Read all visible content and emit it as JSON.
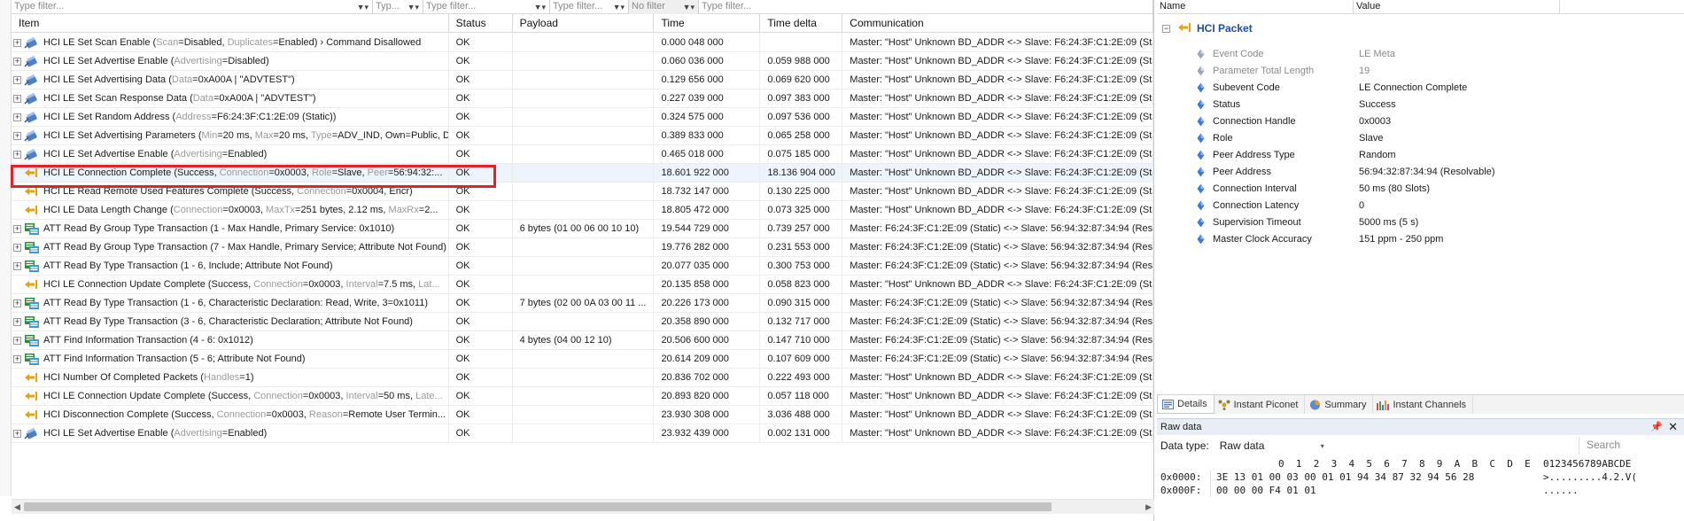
{
  "filters": {
    "item": "Type filter...",
    "status": "Typ...",
    "payload": "Type filter...",
    "time": "Type filter...",
    "delta": "No filter",
    "communication": "Type filter..."
  },
  "columns": {
    "item": "Item",
    "status": "Status",
    "payload": "Payload",
    "time": "Time",
    "delta": "Time delta",
    "communication": "Communication"
  },
  "rows": [
    {
      "kind": "cmd",
      "expand": true,
      "title": "HCI LE Set Scan Enable (",
      "p1k": "Scan",
      "p1v": "=Disabled, ",
      "p2k": "Duplicates",
      "p2v": "=Enabled) › Command Disallowed",
      "p3k": "",
      "p3v": "",
      "status": "OK",
      "payload": "",
      "time": "0.000 048 000",
      "delta": "",
      "comm": "Master: \"Host\" Unknown BD_ADDR <-> Slave: F6:24:3F:C1:2E:09 (Stat"
    },
    {
      "kind": "cmd",
      "expand": true,
      "title": "HCI LE Set Advertise Enable (",
      "p1k": "Advertising",
      "p1v": "=Disabled)",
      "p2k": "",
      "p2v": "",
      "p3k": "",
      "p3v": "",
      "status": "OK",
      "payload": "",
      "time": "0.060 036 000",
      "delta": "0.059 988 000",
      "comm": "Master: \"Host\" Unknown BD_ADDR <-> Slave: F6:24:3F:C1:2E:09 (Stat"
    },
    {
      "kind": "cmd",
      "expand": true,
      "title": "HCI LE Set Advertising Data (",
      "p1k": "Data",
      "p1v": "=0xA00A | \"ADVTEST\")",
      "p2k": "",
      "p2v": "",
      "p3k": "",
      "p3v": "",
      "status": "OK",
      "payload": "",
      "time": "0.129 656 000",
      "delta": "0.069 620 000",
      "comm": "Master: \"Host\" Unknown BD_ADDR <-> Slave: F6:24:3F:C1:2E:09 (Stat"
    },
    {
      "kind": "cmd",
      "expand": true,
      "title": "HCI LE Set Scan Response Data (",
      "p1k": "Data",
      "p1v": "=0xA00A | \"ADVTEST\")",
      "p2k": "",
      "p2v": "",
      "p3k": "",
      "p3v": "",
      "status": "OK",
      "payload": "",
      "time": "0.227 039 000",
      "delta": "0.097 383 000",
      "comm": "Master: \"Host\" Unknown BD_ADDR <-> Slave: F6:24:3F:C1:2E:09 (Stat"
    },
    {
      "kind": "cmd",
      "expand": true,
      "title": "HCI LE Set Random Address (",
      "p1k": "Address",
      "p1v": "=F6:24:3F:C1:2E:09 (Static))",
      "p2k": "",
      "p2v": "",
      "p3k": "",
      "p3v": "",
      "status": "OK",
      "payload": "",
      "time": "0.324 575 000",
      "delta": "0.097 536 000",
      "comm": "Master: \"Host\" Unknown BD_ADDR <-> Slave: F6:24:3F:C1:2E:09 (Stat"
    },
    {
      "kind": "cmd",
      "expand": true,
      "title": "HCI LE Set Advertising Parameters (",
      "p1k": "Min",
      "p1v": "=20 ms, ",
      "p2k": "Max",
      "p2v": "=20 ms, ",
      "p3k": "Type",
      "p3v": "=ADV_IND, Own=Public, D",
      "status": "OK",
      "payload": "",
      "time": "0.389 833 000",
      "delta": "0.065 258 000",
      "comm": "Master: \"Host\" Unknown BD_ADDR <-> Slave: F6:24:3F:C1:2E:09 (Stat"
    },
    {
      "kind": "cmd",
      "expand": true,
      "title": "HCI LE Set Advertise Enable (",
      "p1k": "Advertising",
      "p1v": "=Enabled)",
      "p2k": "",
      "p2v": "",
      "p3k": "",
      "p3v": "",
      "status": "OK",
      "payload": "",
      "time": "0.465 018 000",
      "delta": "0.075 185 000",
      "comm": "Master: \"Host\" Unknown BD_ADDR <-> Slave: F6:24:3F:C1:2E:09 (Stat"
    },
    {
      "kind": "evt",
      "expand": false,
      "title": "HCI LE Connection Complete (Success, ",
      "p1k": "Connection",
      "p1v": "=0x0003, ",
      "p2k": "Role",
      "p2v": "=Slave, ",
      "p3k": "Peer",
      "p3v": "=56:94:32:...",
      "status": "OK",
      "payload": "",
      "time": "18.601 922 000",
      "delta": "18.136 904 000",
      "comm": "Master: \"Host\" Unknown BD_ADDR <-> Slave: F6:24:3F:C1:2E:09 (Stat",
      "selected": true
    },
    {
      "kind": "evt",
      "expand": false,
      "title": "HCI LE Read Remote Used Features Complete (Success, ",
      "p1k": "Connection",
      "p1v": "=0x0004, Encr)",
      "p2k": "",
      "p2v": "",
      "p3k": "",
      "p3v": "",
      "status": "OK",
      "payload": "",
      "time": "18.732 147 000",
      "delta": "0.130 225 000",
      "comm": "Master: \"Host\" Unknown BD_ADDR <-> Slave: F6:24:3F:C1:2E:09 (Stat"
    },
    {
      "kind": "evt",
      "expand": false,
      "title": "HCI LE Data Length Change (",
      "p1k": "Connection",
      "p1v": "=0x0003, ",
      "p2k": "MaxTx",
      "p2v": "=251 bytes, 2.12 ms, ",
      "p3k": "MaxRx",
      "p3v": "=2...",
      "status": "OK",
      "payload": "",
      "time": "18.805 472 000",
      "delta": "0.073 325 000",
      "comm": "Master: \"Host\" Unknown BD_ADDR <-> Slave: F6:24:3F:C1:2E:09 (Stat"
    },
    {
      "kind": "att",
      "expand": true,
      "title": "ATT Read By Group Type Transaction (1 - Max Handle, Primary Service: 0x1010)",
      "p1k": "",
      "p1v": "",
      "p2k": "",
      "p2v": "",
      "p3k": "",
      "p3v": "",
      "status": "OK",
      "payload": "6 bytes (01 00 06 00 10 10)",
      "time": "19.544 729 000",
      "delta": "0.739 257 000",
      "comm": "Master: F6:24:3F:C1:2E:09 (Static) <-> Slave: 56:94:32:87:34:94 (Res"
    },
    {
      "kind": "att",
      "expand": true,
      "title": "ATT Read By Group Type Transaction (7 - Max Handle, Primary Service; Attribute Not Found)",
      "p1k": "",
      "p1v": "",
      "p2k": "",
      "p2v": "",
      "p3k": "",
      "p3v": "",
      "status": "OK",
      "payload": "",
      "time": "19.776 282 000",
      "delta": "0.231 553 000",
      "comm": "Master: F6:24:3F:C1:2E:09 (Static) <-> Slave: 56:94:32:87:34:94 (Res"
    },
    {
      "kind": "att",
      "expand": true,
      "title": "ATT Read By Type Transaction (1 - 6, Include; Attribute Not Found)",
      "p1k": "",
      "p1v": "",
      "p2k": "",
      "p2v": "",
      "p3k": "",
      "p3v": "",
      "status": "OK",
      "payload": "",
      "time": "20.077 035 000",
      "delta": "0.300 753 000",
      "comm": "Master: F6:24:3F:C1:2E:09 (Static) <-> Slave: 56:94:32:87:34:94 (Res"
    },
    {
      "kind": "evt",
      "expand": false,
      "title": "HCI LE Connection Update Complete (Success, ",
      "p1k": "Connection",
      "p1v": "=0x0003, ",
      "p2k": "Interval",
      "p2v": "=7.5 ms, ",
      "p3k": "Lat...",
      "p3v": "",
      "status": "OK",
      "payload": "",
      "time": "20.135 858 000",
      "delta": "0.058 823 000",
      "comm": "Master: \"Host\" Unknown BD_ADDR <-> Slave: F6:24:3F:C1:2E:09 (Stat"
    },
    {
      "kind": "att",
      "expand": true,
      "title": "ATT Read By Type Transaction (1 - 6, Characteristic Declaration: Read, Write, 3=0x1011)",
      "p1k": "",
      "p1v": "",
      "p2k": "",
      "p2v": "",
      "p3k": "",
      "p3v": "",
      "status": "OK",
      "payload": "7 bytes (02 00 0A 03 00 11 ...",
      "time": "20.226 173 000",
      "delta": "0.090 315 000",
      "comm": "Master: F6:24:3F:C1:2E:09 (Static) <-> Slave: 56:94:32:87:34:94 (Res"
    },
    {
      "kind": "att",
      "expand": true,
      "title": "ATT Read By Type Transaction (3 - 6, Characteristic Declaration; Attribute Not Found)",
      "p1k": "",
      "p1v": "",
      "p2k": "",
      "p2v": "",
      "p3k": "",
      "p3v": "",
      "status": "OK",
      "payload": "",
      "time": "20.358 890 000",
      "delta": "0.132 717 000",
      "comm": "Master: F6:24:3F:C1:2E:09 (Static) <-> Slave: 56:94:32:87:34:94 (Res"
    },
    {
      "kind": "att",
      "expand": true,
      "title": "ATT Find Information Transaction (4 - 6: 0x1012)",
      "p1k": "",
      "p1v": "",
      "p2k": "",
      "p2v": "",
      "p3k": "",
      "p3v": "",
      "status": "OK",
      "payload": "4 bytes (04 00 12 10)",
      "time": "20.506 600 000",
      "delta": "0.147 710 000",
      "comm": "Master: F6:24:3F:C1:2E:09 (Static) <-> Slave: 56:94:32:87:34:94 (Res"
    },
    {
      "kind": "att",
      "expand": true,
      "title": "ATT Find Information Transaction (5 - 6; Attribute Not Found)",
      "p1k": "",
      "p1v": "",
      "p2k": "",
      "p2v": "",
      "p3k": "",
      "p3v": "",
      "status": "OK",
      "payload": "",
      "time": "20.614 209 000",
      "delta": "0.107 609 000",
      "comm": "Master: F6:24:3F:C1:2E:09 (Static) <-> Slave: 56:94:32:87:34:94 (Res"
    },
    {
      "kind": "evt",
      "expand": false,
      "title": "HCI Number Of Completed Packets (",
      "p1k": "Handles",
      "p1v": "=1)",
      "p2k": "",
      "p2v": "",
      "p3k": "",
      "p3v": "",
      "status": "OK",
      "payload": "",
      "time": "20.836 702 000",
      "delta": "0.222 493 000",
      "comm": "Master: \"Host\" Unknown BD_ADDR <-> Slave: F6:24:3F:C1:2E:09 (Stat"
    },
    {
      "kind": "evt",
      "expand": false,
      "title": "HCI LE Connection Update Complete (Success, ",
      "p1k": "Connection",
      "p1v": "=0x0003, ",
      "p2k": "Interval",
      "p2v": "=50 ms, ",
      "p3k": "Late...",
      "p3v": "",
      "status": "OK",
      "payload": "",
      "time": "20.893 820 000",
      "delta": "0.057 118 000",
      "comm": "Master: \"Host\" Unknown BD_ADDR <-> Slave: F6:24:3F:C1:2E:09 (Stat"
    },
    {
      "kind": "evt",
      "expand": false,
      "title": "HCI Disconnection Complete (Success, ",
      "p1k": "Connection",
      "p1v": "=0x0003, ",
      "p2k": "Reason",
      "p2v": "=Remote User Termin...",
      "p3k": "",
      "p3v": "",
      "status": "OK",
      "payload": "",
      "time": "23.930 308 000",
      "delta": "3.036 488 000",
      "comm": "Master: \"Host\" Unknown BD_ADDR <-> Slave: F6:24:3F:C1:2E:09 (Stat"
    },
    {
      "kind": "cmd",
      "expand": true,
      "title": "HCI LE Set Advertise Enable (",
      "p1k": "Advertising",
      "p1v": "=Enabled)",
      "p2k": "",
      "p2v": "",
      "p3k": "",
      "p3v": "",
      "status": "OK",
      "payload": "",
      "time": "23.932 439 000",
      "delta": "0.002 131 000",
      "comm": "Master: \"Host\" Unknown BD_ADDR <-> Slave: F6:24:3F:C1:2E:09 (Stat"
    }
  ],
  "props": {
    "header_name": "Name",
    "header_value": "Value",
    "packet_title": "HCI Packet",
    "items": [
      {
        "name": "Event Code",
        "value": "LE Meta",
        "dim": true
      },
      {
        "name": "Parameter Total Length",
        "value": "19",
        "dim": true
      },
      {
        "name": "Subevent Code",
        "value": "LE Connection Complete",
        "dim": false
      },
      {
        "name": "Status",
        "value": "Success",
        "dim": false
      },
      {
        "name": "Connection Handle",
        "value": "0x0003",
        "dim": false
      },
      {
        "name": "Role",
        "value": "Slave",
        "dim": false
      },
      {
        "name": "Peer Address Type",
        "value": "Random",
        "dim": false
      },
      {
        "name": "Peer Address",
        "value": "56:94:32:87:34:94 (Resolvable)",
        "dim": false
      },
      {
        "name": "Connection Interval",
        "value": "50 ms (80 Slots)",
        "dim": false
      },
      {
        "name": "Connection Latency",
        "value": "0",
        "dim": false
      },
      {
        "name": "Supervision Timeout",
        "value": "5000 ms (5 s)",
        "dim": false
      },
      {
        "name": "Master Clock Accuracy",
        "value": "151 ppm - 250 ppm",
        "dim": false
      }
    ]
  },
  "tabs": [
    "Details",
    "Instant Piconet",
    "Summary",
    "Instant Channels"
  ],
  "raw": {
    "title": "Raw data",
    "pin": "▕",
    "close": "✕",
    "data_type_label": "Data type:",
    "data_type_value": "Raw data",
    "search_placeholder": "Search",
    "hex_header": "0  1  2  3  4  5  6  7  8  9  A  B  C  D  E",
    "ascii_header": "0123456789ABCDE",
    "lines": [
      {
        "addr": "0x0000:",
        "bytes": "3E 13 01 00 03 00 01 01 94 34 87 32 94 56 28",
        "ascii": ">.........4.2.V("
      },
      {
        "addr": "0x000F:",
        "bytes": "00 00 00 F4 01 01",
        "ascii": "......"
      }
    ]
  },
  "colors": {
    "highlight": "#e0222a",
    "accent": "#1f4e9a"
  }
}
